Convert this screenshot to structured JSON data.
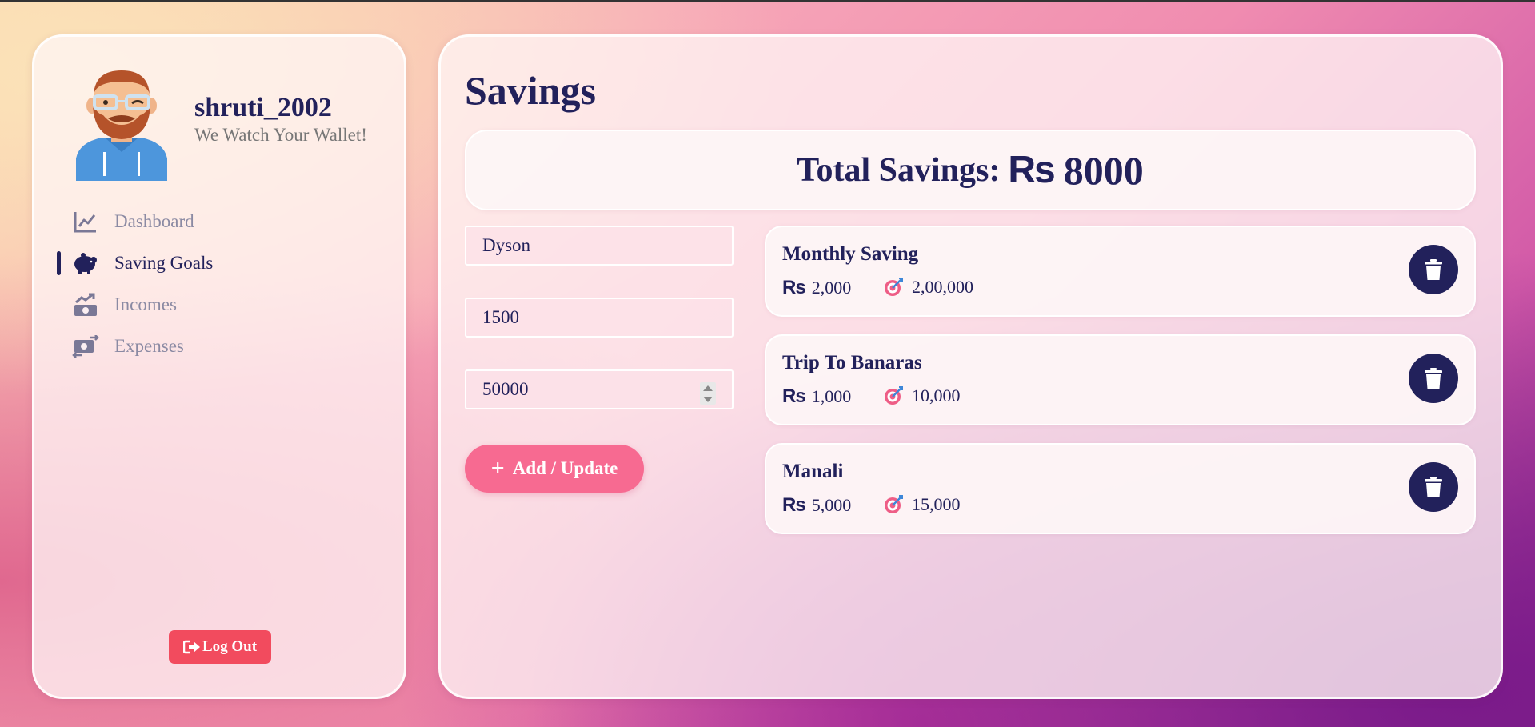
{
  "user": {
    "username": "shruti_2002",
    "tagline": "We Watch Your Wallet!"
  },
  "sidebar": {
    "items": [
      {
        "label": "Dashboard",
        "icon": "line-chart-icon",
        "active": false
      },
      {
        "label": "Saving Goals",
        "icon": "piggy-bank-icon",
        "active": true
      },
      {
        "label": "Incomes",
        "icon": "money-trend-icon",
        "active": false
      },
      {
        "label": "Expenses",
        "icon": "money-exchange-icon",
        "active": false
      }
    ],
    "logout_label": "Log Out"
  },
  "main": {
    "title": "Savings",
    "total_label": "Total Savings:",
    "currency_symbol": "Rs",
    "total_amount": "8000",
    "form": {
      "name_value": "Dyson",
      "amount_value": "1500",
      "target_value": "50000",
      "submit_label": "Add / Update"
    },
    "goals": [
      {
        "name": "Monthly Saving",
        "saved": "2,000",
        "target": "2,00,000"
      },
      {
        "name": "Trip To Banaras",
        "saved": "1,000",
        "target": "10,000"
      },
      {
        "name": "Manali",
        "saved": "5,000",
        "target": "15,000"
      }
    ]
  },
  "colors": {
    "primary": "#22215b",
    "accent": "#f76a91",
    "logout": "#f24b5e",
    "muted": "#8b8aa3"
  }
}
